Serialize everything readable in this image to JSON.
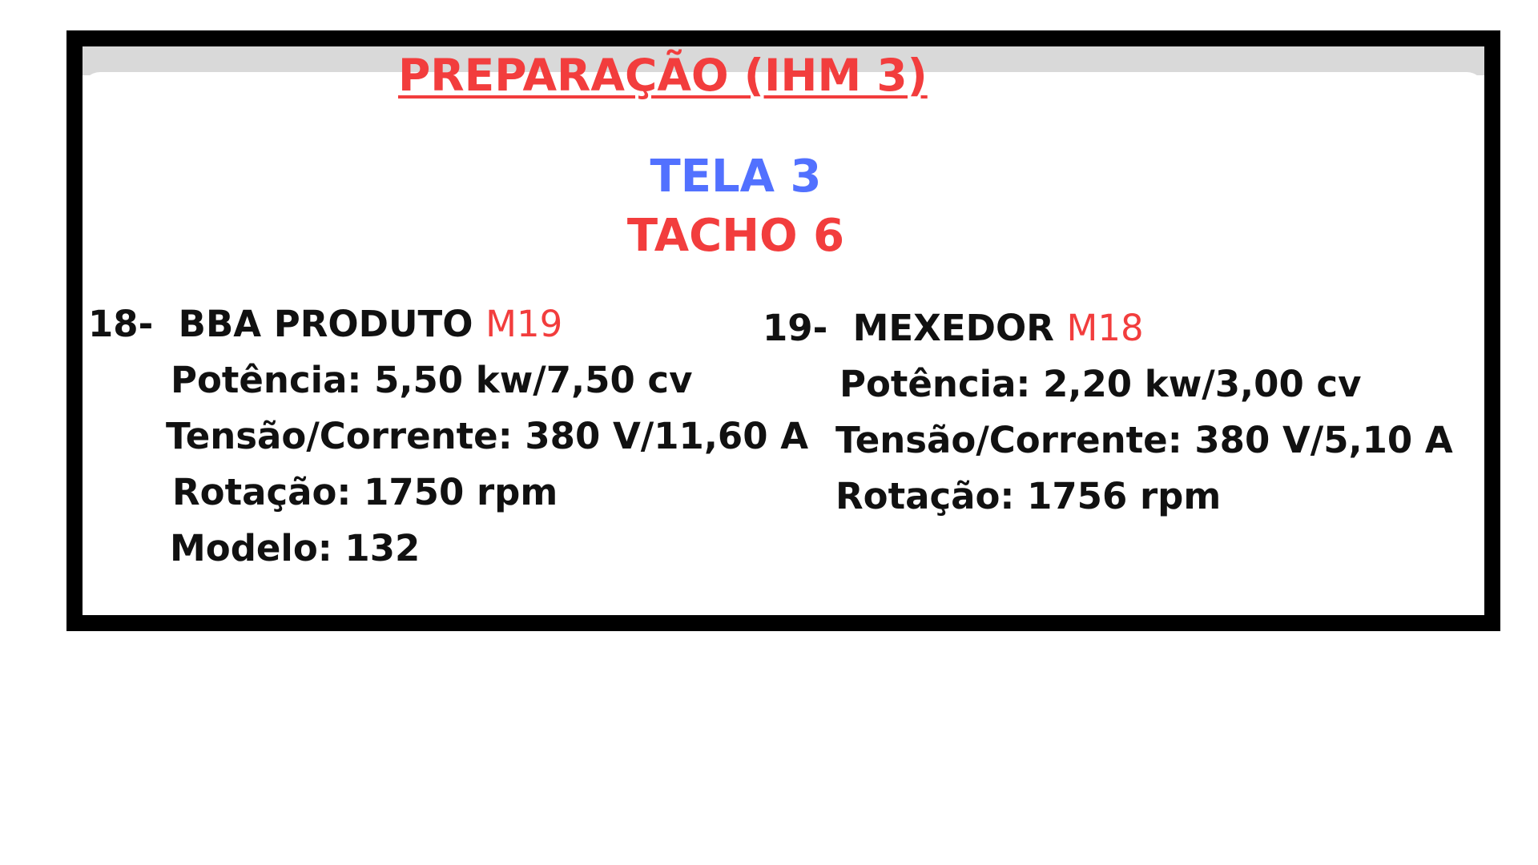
{
  "colors": {
    "accent_red": "#f23d3d",
    "accent_blue": "#5271ff",
    "text": "#111111",
    "frame": "#000000"
  },
  "header": {
    "title": "PREPARAÇÃO (IHM 3)",
    "screen": "TELA 3",
    "tank": "TACHO 6"
  },
  "equipment": [
    {
      "number": "18-",
      "name": "BBA  PRODUTO",
      "tag": "M19",
      "power": "Potência: 5,50 kw/7,50 cv",
      "voltage_current": "Tensão/Corrente: 380 V/11,60 A",
      "rotation": "Rotação: 1750 rpm",
      "model": "Modelo: 132"
    },
    {
      "number": "19-",
      "name": "MEXEDOR",
      "tag": "M18",
      "power": "Potência: 2,20 kw/3,00 cv",
      "voltage_current": "Tensão/Corrente: 380 V/5,10 A",
      "rotation": "Rotação: 1756 rpm"
    }
  ]
}
